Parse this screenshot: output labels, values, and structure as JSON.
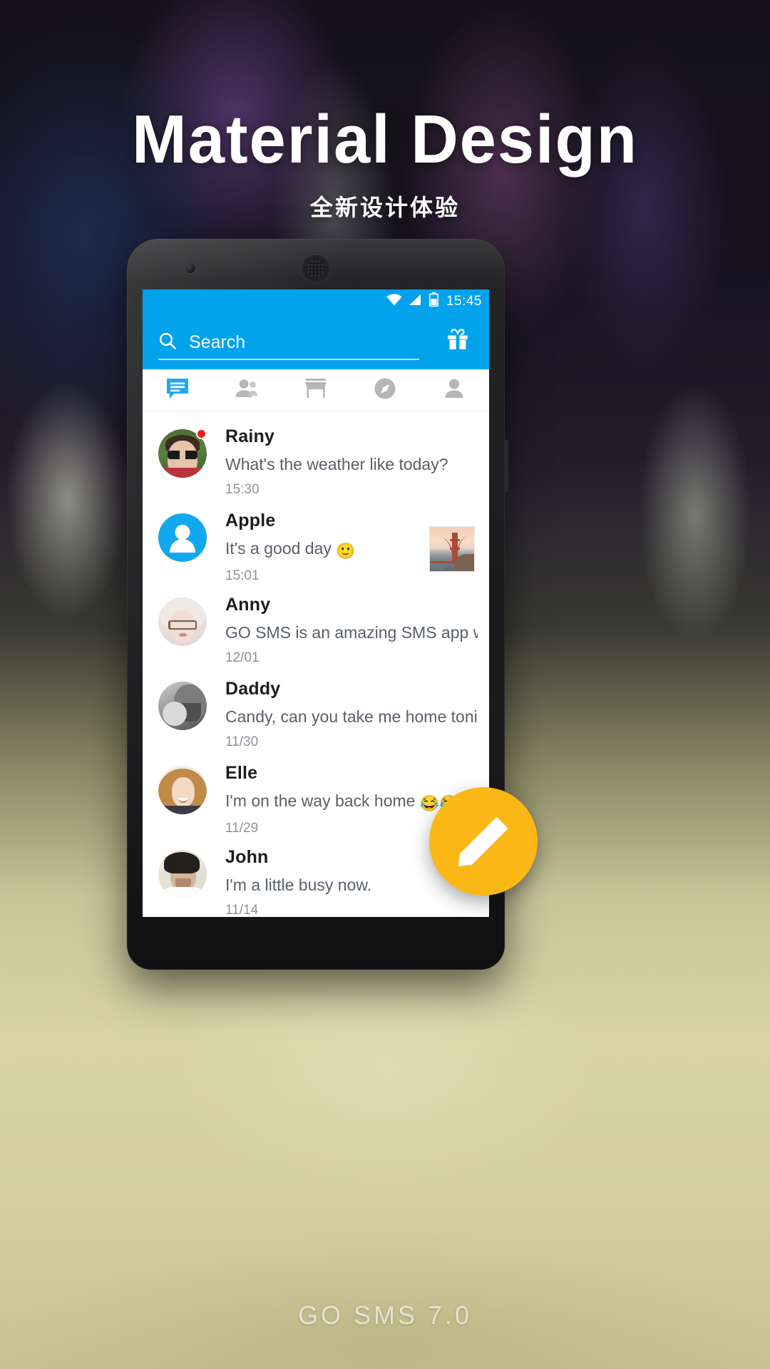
{
  "hero": {
    "title": "Material Design",
    "subtitle": "全新设计体验"
  },
  "footer": {
    "caption": "GO SMS 7.0"
  },
  "colors": {
    "accent_blue": "#03a3ec",
    "fab_amber": "#fbb716",
    "unread_red": "#f21b1b",
    "tab_inactive": "#b6b6b6",
    "text_primary": "#1d1d1d",
    "text_secondary": "#5a6068",
    "text_tertiary": "#8d9299"
  },
  "phone": {
    "statusbar": {
      "time": "15:45",
      "icons": [
        "wifi-icon",
        "signal-icon",
        "battery-icon"
      ]
    },
    "search": {
      "icon": "search-icon",
      "placeholder": "Search",
      "action_icon": "gift-icon"
    },
    "tabs": [
      {
        "name": "messages",
        "icon": "chat-bubble-icon",
        "active": true
      },
      {
        "name": "contacts",
        "icon": "people-icon",
        "active": false
      },
      {
        "name": "store",
        "icon": "store-icon",
        "active": false
      },
      {
        "name": "discover",
        "icon": "compass-icon",
        "active": false
      },
      {
        "name": "profile",
        "icon": "person-icon",
        "active": false
      }
    ],
    "conversations": [
      {
        "name": "Rainy",
        "snippet": "What's the weather like today?",
        "time": "15:30",
        "unread": true,
        "avatar": "photo-man-sunglasses",
        "thumb": null
      },
      {
        "name": "Apple",
        "snippet": "It's a good day ",
        "emoji": "🙂",
        "time": "15:01",
        "unread": false,
        "avatar": "default-person-blue",
        "thumb": "golden-gate-bridge"
      },
      {
        "name": "Anny",
        "snippet": "GO SMS is an amazing SMS app with co...",
        "time": "12/01",
        "unread": false,
        "avatar": "photo-woman-glasses",
        "thumb": null
      },
      {
        "name": "Daddy",
        "snippet": "Candy, can you take me home tonight?",
        "time": "11/30",
        "unread": false,
        "avatar": "photo-man-baby-bw",
        "thumb": null
      },
      {
        "name": "Elle",
        "snippet": "I'm on the way back home ",
        "emoji": "😂😂",
        "time": "11/29",
        "unread": false,
        "avatar": "photo-woman-smiling",
        "thumb": null
      },
      {
        "name": "John",
        "snippet": "I'm a little busy now.",
        "time": "11/14",
        "unread": false,
        "avatar": "photo-man-white-shirt",
        "thumb": null
      }
    ],
    "fab": {
      "icon": "pencil-compose-icon"
    }
  }
}
